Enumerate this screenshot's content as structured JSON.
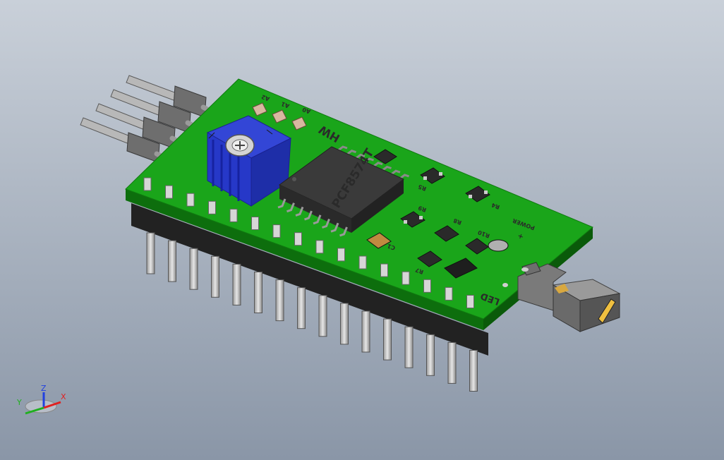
{
  "scene": {
    "background_top": "#c9d0d9",
    "background_bottom": "#8a96a7",
    "pcb_color": "#1aa51a",
    "pcb_edge_color": "#0d6e0d",
    "trimmer_color": "#2638c8",
    "chip_color": "#3a3a3a",
    "pin_color": "#c8c8c8",
    "header_color": "#222222"
  },
  "silkscreen": {
    "chip_label": "PCF8574T",
    "brand": "HW",
    "a2": "A2",
    "a1": "A1",
    "a0": "A0",
    "r5": "R5",
    "r4": "R4",
    "r8": "R8",
    "r9": "R9",
    "r10": "R10",
    "r7": "R7",
    "c1": "C1",
    "power": "POWER",
    "plus": "+",
    "led": "LED"
  },
  "triad": {
    "x_label": "X",
    "y_label": "Y",
    "z_label": "Z",
    "x_color": "#e02020",
    "y_color": "#20b020",
    "z_color": "#2040e0"
  }
}
